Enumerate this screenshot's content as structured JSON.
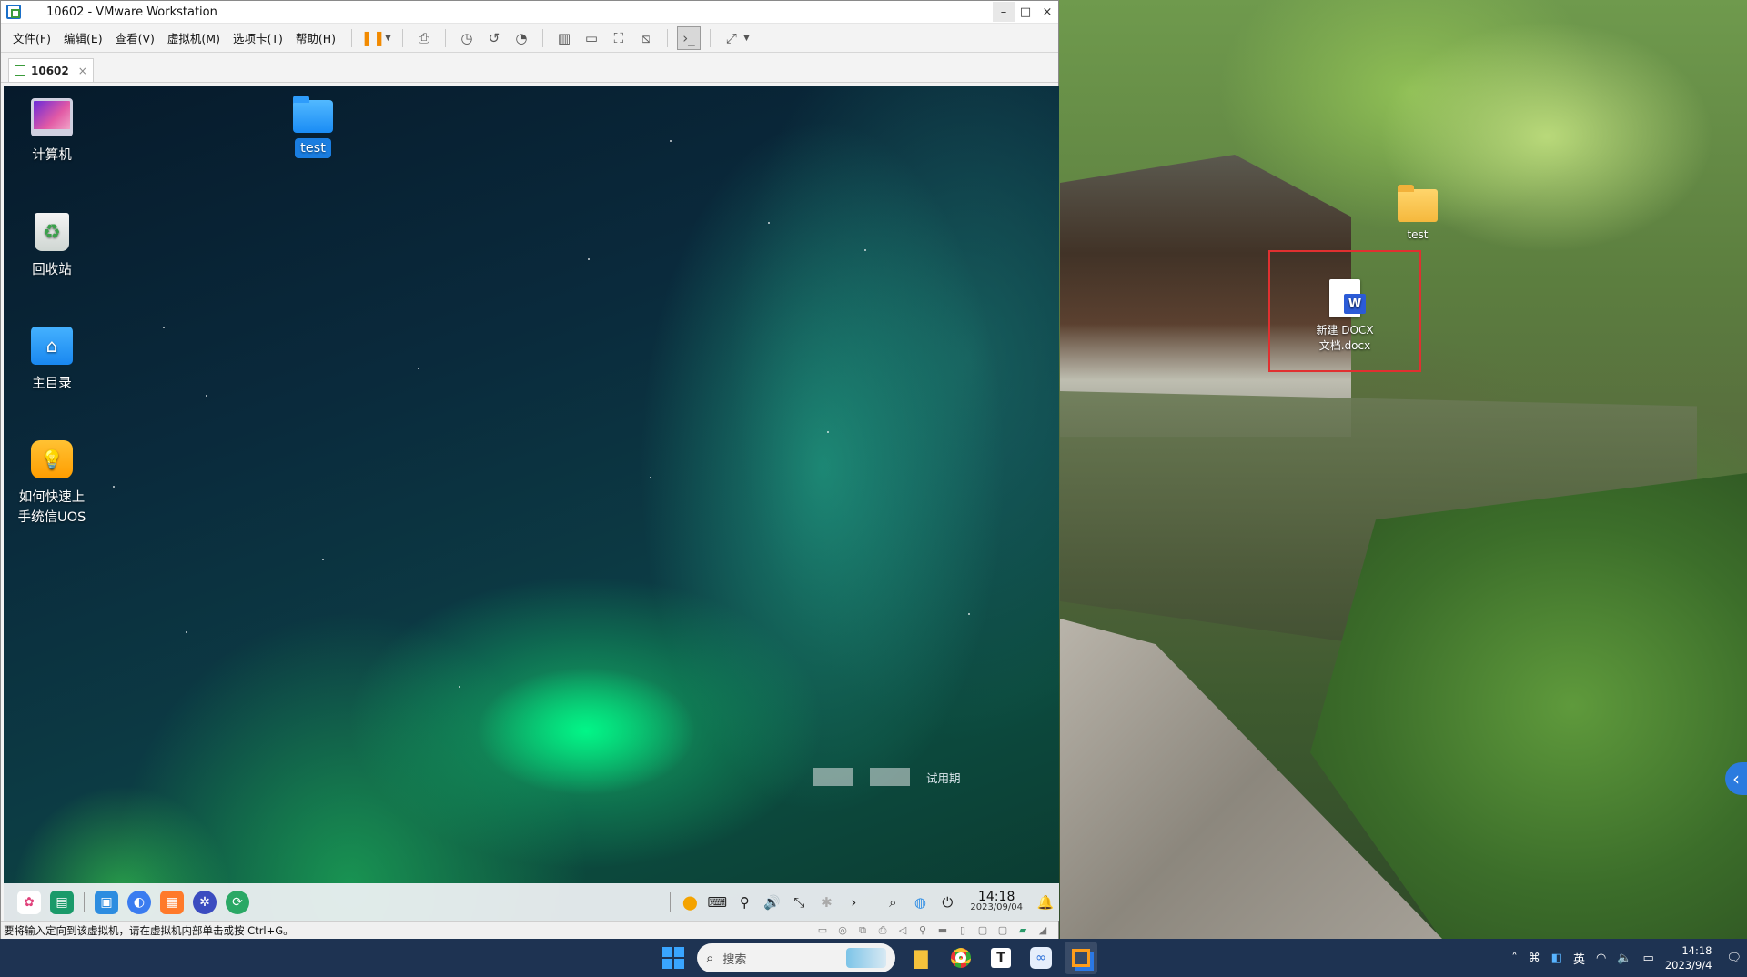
{
  "window": {
    "title": "10602 - VMware Workstation",
    "controls": {
      "minimize": "–",
      "maximize": "□",
      "close": "×"
    }
  },
  "menu": [
    {
      "label": "文件(F)"
    },
    {
      "label": "编辑(E)"
    },
    {
      "label": "查看(V)"
    },
    {
      "label": "虚拟机(M)"
    },
    {
      "label": "选项卡(T)"
    },
    {
      "label": "帮助(H)"
    }
  ],
  "tab": {
    "label": "10602",
    "close": "×"
  },
  "guest": {
    "desktop_icons": {
      "computer": "计算机",
      "trash": "回收站",
      "home": "主目录",
      "howto": "如何快速上\n手统信UOS",
      "test": "test"
    },
    "watermark": "试用期",
    "clock": {
      "time": "14:18",
      "date": "2023/09/04"
    }
  },
  "statusbar": {
    "message": "要将输入定向到该虚拟机，请在虚拟机内部单击或按 Ctrl+G。"
  },
  "host": {
    "desktop_icons": {
      "test": "test",
      "docx_line1": "新建 DOCX",
      "docx_line2": "文档.docx"
    },
    "taskbar": {
      "search_placeholder": "搜索",
      "ime": "英",
      "time": "14:18",
      "date": "2023/9/4"
    }
  },
  "colors": {
    "accent": "#1a7de0",
    "highlight_box": "#e03030",
    "taskbar": "#1e3352"
  }
}
